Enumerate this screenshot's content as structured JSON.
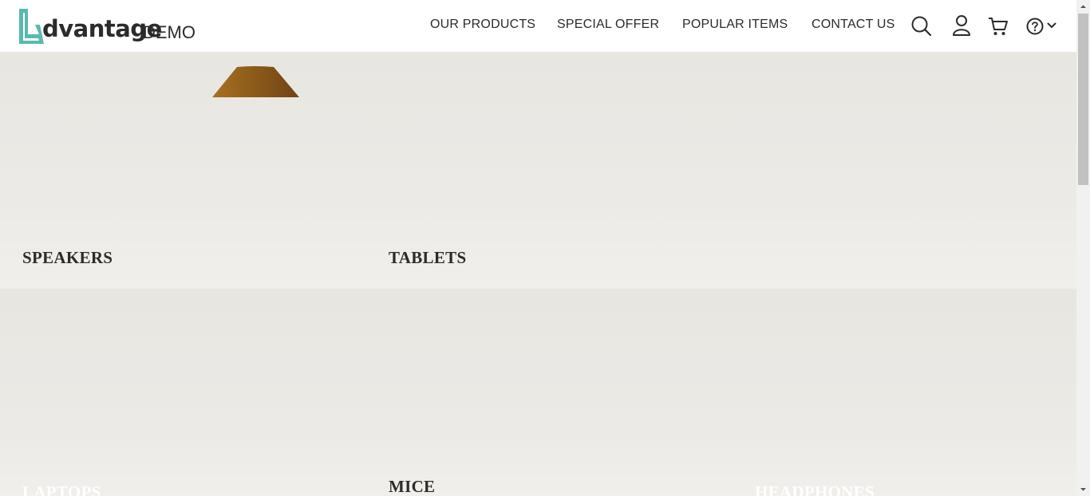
{
  "header": {
    "logo_text": "dvantage",
    "logo_demo": "DEMO",
    "nav": [
      {
        "label": "OUR PRODUCTS"
      },
      {
        "label": "SPECIAL OFFER"
      },
      {
        "label": "POPULAR ITEMS"
      },
      {
        "label": "CONTACT US"
      }
    ],
    "icons": [
      "search-icon",
      "user-icon",
      "cart-icon",
      "help-icon",
      "chevron-down-icon"
    ]
  },
  "categories": {
    "speakers": "SPEAKERS",
    "tablets": "TABLETS",
    "laptops": "LAPTOPS",
    "mice": "MICE",
    "headphones": "HEADPHONES"
  },
  "colors": {
    "brand_teal": "#5ab9b0",
    "text_dark": "#2b2b2b",
    "panel_bg": "#e9e7e2",
    "speaker_brown": "#8b5a1b"
  }
}
